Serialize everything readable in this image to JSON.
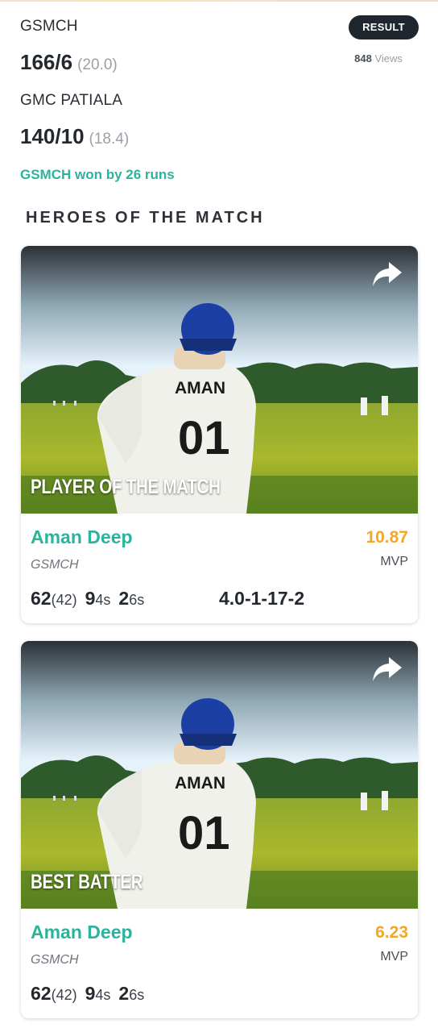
{
  "match": {
    "team1": {
      "name": "GSMCH",
      "score": "166/6",
      "overs": "(20.0)"
    },
    "team2": {
      "name": "GMC PATIALA",
      "score": "140/10",
      "overs": "(18.4)"
    },
    "result_label": "RESULT",
    "views_count": "848",
    "views_label": "Views",
    "result_text": "GSMCH won by 26 runs"
  },
  "section_title": "HEROES OF THE MATCH",
  "cards": [
    {
      "award": "PLAYER OF THE MATCH",
      "jersey_name": "AMAN",
      "jersey_number": "01",
      "player": "Aman Deep",
      "team": "GSMCH",
      "mvp_value": "10.87",
      "mvp_label": "MVP",
      "runs": "62",
      "balls": "(42)",
      "fours": "9",
      "fours_label": "4s",
      "sixes": "2",
      "sixes_label": "6s",
      "bowling": "4.0-1-17-2"
    },
    {
      "award": "BEST BATTER",
      "jersey_name": "AMAN",
      "jersey_number": "01",
      "player": "Aman Deep",
      "team": "GSMCH",
      "mvp_value": "6.23",
      "mvp_label": "MVP",
      "runs": "62",
      "balls": "(42)",
      "fours": "9",
      "fours_label": "4s",
      "sixes": "2",
      "sixes_label": "6s"
    }
  ],
  "icons": {
    "share": "share-arrow-icon"
  },
  "colors": {
    "accent_green": "#2bb39d",
    "mvp_orange": "#f5a623",
    "badge_dark": "#1f262e"
  }
}
